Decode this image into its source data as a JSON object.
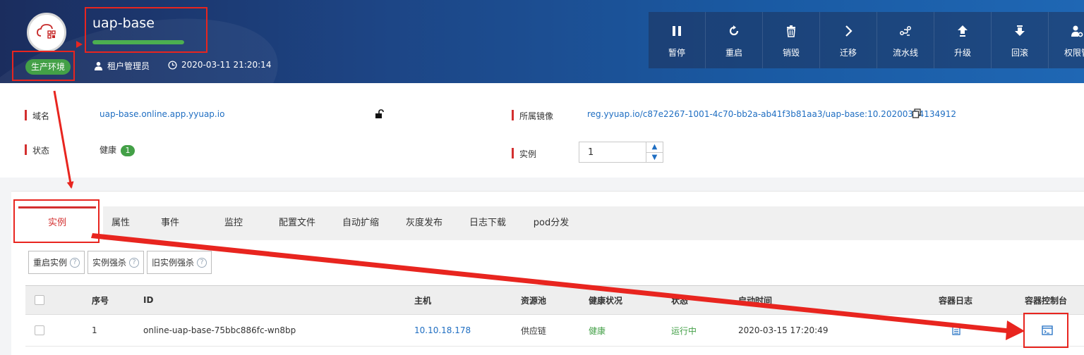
{
  "header": {
    "app_title": "uap-base",
    "env_badge": "生产环境",
    "progress_fraction": 1.0,
    "user": "租户管理员",
    "timestamp": "2020-03-11 21:20:14",
    "colors": {
      "accent": "#4caf50",
      "badge": "#43a047",
      "annotation": "#e8251f"
    }
  },
  "toolbar": [
    {
      "label": "暂停",
      "icon": "pause-icon"
    },
    {
      "label": "重启",
      "icon": "restart-icon"
    },
    {
      "label": "销毁",
      "icon": "trash-icon"
    },
    {
      "label": "迁移",
      "icon": "chevron-right-icon"
    },
    {
      "label": "流水线",
      "icon": "pipeline-icon"
    },
    {
      "label": "升级",
      "icon": "upgrade-icon"
    },
    {
      "label": "回滚",
      "icon": "rollback-icon"
    },
    {
      "label": "权限管",
      "icon": "user-settings-icon"
    }
  ],
  "info": {
    "domain_label": "域名",
    "domain_value": "uap-base.online.app.yyuap.io",
    "status_label": "状态",
    "status_value": "健康",
    "status_count": "1",
    "image_label": "所属镜像",
    "image_value": "reg.yyuap.io/c87e2267-1001-4c70-bb2a-ab41f3b81aa3/uap-base:10.20200314134912",
    "instance_label": "实例",
    "instance_value": "1"
  },
  "tabs": [
    {
      "label": "实例",
      "active": true
    },
    {
      "label": "属性"
    },
    {
      "label": "事件"
    },
    {
      "label": "监控"
    },
    {
      "label": "配置文件"
    },
    {
      "label": "自动扩缩"
    },
    {
      "label": "灰度发布"
    },
    {
      "label": "日志下载"
    },
    {
      "label": "pod分发"
    }
  ],
  "actions": [
    {
      "label": "重启实例"
    },
    {
      "label": "实例强杀"
    },
    {
      "label": "旧实例强杀"
    }
  ],
  "table": {
    "headers": {
      "index": "序号",
      "id": "ID",
      "host": "主机",
      "pool": "资源池",
      "health": "健康状况",
      "status": "状态",
      "start_time": "启动时间",
      "log": "容器日志",
      "console": "容器控制台"
    },
    "rows": [
      {
        "index": "1",
        "id": "online-uap-base-75bbc886fc-wn8bp",
        "host": "10.10.18.178",
        "pool": "供应链",
        "health": "健康",
        "status": "运行中",
        "start_time": "2020-03-15 17:20:49"
      }
    ]
  }
}
